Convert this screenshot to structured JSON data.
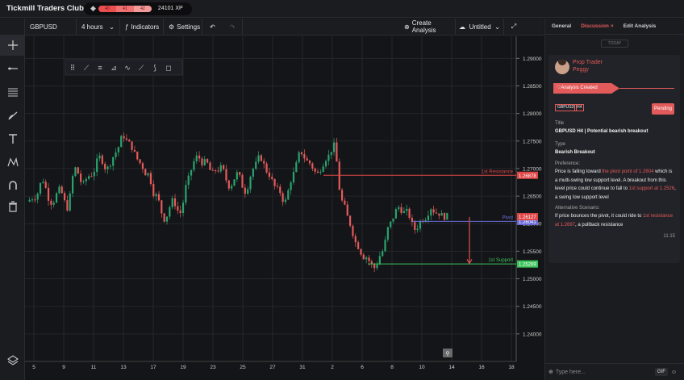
{
  "app": {
    "title": "Tickmill Traders Club",
    "xp_segments": [
      "40",
      "41",
      "42"
    ],
    "xp": "24101 XP"
  },
  "toolbar": {
    "symbol": "GBPUSD",
    "interval": "4 hours",
    "indicators": "Indicators",
    "settings": "Settings",
    "create_analysis": "Create Analysis",
    "layout_name": "Untitled"
  },
  "right_panel": {
    "tabs": [
      "General",
      "Discussion",
      "Edit Analysis"
    ],
    "active_tab": "Discussion",
    "divider": "TODAY",
    "user": {
      "role": "Prop Trader",
      "name": "Peggy"
    },
    "event": "Analysis Created",
    "tags": [
      "GBPUSD",
      "H4"
    ],
    "status": "Pending",
    "title_label": "Title",
    "title": "GBPUSD H4 | Potential bearish breakout",
    "type_label": "Type",
    "type": "Bearish Breakout",
    "preference_label": "Preference:",
    "preference": [
      "Price is falling toward ",
      "the pivot point of 1.2604",
      " which is a multi-swing low support level. A breakout from this level price could continue to fall to ",
      "1st support at 1.2526",
      ", a swing low support level"
    ],
    "alternative_label": "Alternative Scenario:",
    "alternative": [
      "If price bounces the pivot, it could ride to ",
      "1st resistance at 1.2697",
      ", a pullback resistance"
    ],
    "time": "11:15",
    "input_placeholder": "Type here...",
    "gif": "GIF"
  },
  "chart_data": {
    "type": "candlestick",
    "symbol": "GBPUSD",
    "interval": "4 hours",
    "y_ticks": [
      "1.29000",
      "1.28500",
      "1.28000",
      "1.27500",
      "1.27000",
      "1.26500",
      "1.26000",
      "1.25500",
      "1.25000",
      "1.24500",
      "1.24000"
    ],
    "ylim": [
      1.235,
      1.294
    ],
    "x_ticks": [
      "5",
      "9",
      "11",
      "13",
      "17",
      "19",
      "23",
      "25",
      "27",
      "31",
      "2",
      "6",
      "8",
      "10",
      "14",
      "16",
      "18"
    ],
    "levels": [
      {
        "name": "1st Resistance",
        "value": 1.26878,
        "label": "1.26878",
        "color": "#e04848"
      },
      {
        "name": "Pivot",
        "value": 1.26041,
        "label": "1.26041",
        "color": "#6b6bd8"
      },
      {
        "name": "1st Support",
        "value": 1.25269,
        "label": "1.25269",
        "color": "#3cc35b"
      }
    ],
    "last_price": {
      "label": "1.26127",
      "value": 1.26127,
      "color": "#e04848"
    },
    "projection": {
      "from": 1.2612,
      "to": 1.2528,
      "color": "#e05050"
    },
    "series_close": [
      1.265,
      1.268,
      1.264,
      1.266,
      1.263,
      1.27,
      1.267,
      1.269,
      1.272,
      1.27,
      1.273,
      1.276,
      1.274,
      1.271,
      1.269,
      1.265,
      1.261,
      1.264,
      1.262,
      1.268,
      1.272,
      1.271,
      1.269,
      1.27,
      1.267,
      1.269,
      1.266,
      1.27,
      1.272,
      1.269,
      1.266,
      1.264,
      1.269,
      1.273,
      1.271,
      1.269,
      1.272,
      1.274,
      1.264,
      1.26,
      1.256,
      1.254,
      1.252,
      1.255,
      1.26,
      1.263,
      1.262,
      1.259,
      1.261,
      1.263,
      1.262,
      1.2612
    ]
  }
}
